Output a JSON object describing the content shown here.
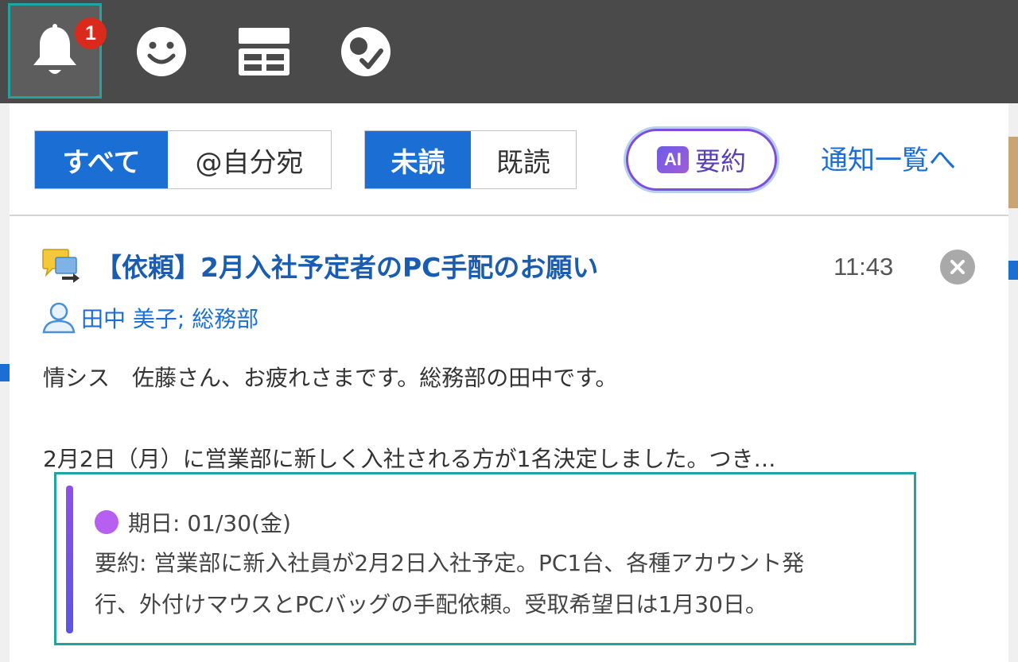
{
  "header": {
    "notification_badge": "1",
    "icons": [
      "bell-icon",
      "smiley-icon",
      "layout-icon",
      "check-bubble-icon"
    ]
  },
  "filters": {
    "scope": {
      "all_label": "すべて",
      "mine_label": "@自分宛",
      "selected": "すべて"
    },
    "read_state": {
      "unread_label": "未読",
      "read_label": "既読",
      "selected": "未読"
    },
    "ai_chip": "AI",
    "ai_summary_label": "要約",
    "notification_list_link": "通知一覧へ"
  },
  "notification": {
    "title": "【依頼】2月入社予定者のPC手配のお願い",
    "time": "11:43",
    "sender": "田中 美子; 総務部",
    "body_line1": "情シス　佐藤さん、お疲れさまです。総務部の田中です。",
    "body_line2": "2月2日（月）に営業部に新しく入社される方が1名決定しました。つき…",
    "summary": {
      "due": "期日: 01/30(金)",
      "line1": "要約: 営業部に新入社員が2月2日入社予定。PC1台、各種アカウント発",
      "line2": "行、外付けマウスとPCバッグの手配依頼。受取希望日は1月30日。"
    }
  },
  "colors": {
    "header_bg": "#4a4a4a",
    "accent_blue": "#1b6fd4",
    "badge_red": "#d92a1c",
    "highlight_teal": "#21a3a0",
    "ai_purple": "#7c4ed9"
  }
}
